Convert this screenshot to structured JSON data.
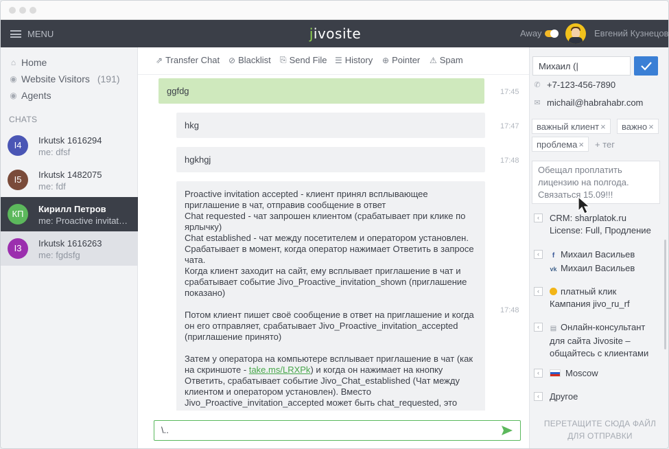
{
  "topbar": {
    "menu_label": "MENU",
    "logo_j": "j",
    "logo_rest": "ivosite",
    "status": "Away",
    "user_name": "Евгений Кузнецов"
  },
  "sidebar": {
    "nav": [
      {
        "label": "Home",
        "icon": "home-icon"
      },
      {
        "label": "Website Visitors",
        "count": "(191)",
        "icon": "visitors-icon"
      },
      {
        "label": "Agents",
        "icon": "agents-icon"
      }
    ],
    "chats_heading": "CHATS",
    "chats": [
      {
        "initials": "I4",
        "name": "Irkutsk 1616294",
        "preview": "me: dfsf",
        "color": "#4a56b5"
      },
      {
        "initials": "I5",
        "name": "Irkutsk 1482075",
        "preview": "me: fdf",
        "color": "#7a4b3a"
      },
      {
        "initials": "КП",
        "name": "Кирилл Петров",
        "preview": "me: Proactive invitation accepted",
        "color": "#5cb85c"
      },
      {
        "initials": "I3",
        "name": "Irkutsk 1616263",
        "preview": "me: fgdsfg",
        "color": "#9b2fae"
      }
    ]
  },
  "toolbar": {
    "transfer": "Transfer Chat",
    "blacklist": "Blacklist",
    "send_file": "Send File",
    "history": "History",
    "pointer": "Pointer",
    "spam": "Spam"
  },
  "messages": [
    {
      "text": "ggfdg",
      "time": "17:45"
    },
    {
      "text": "hkg",
      "time": "17:47"
    },
    {
      "text": "hgkhgj",
      "time": "17:48"
    },
    {
      "time": "17:48",
      "p1": "Proactive invitation accepted - клиент принял всплывающее приглашение в чат, отправив сообщение в ответ\nChat requested - чат запрошен клиентом (срабатывает при клике по ярлычку)\nChat established - чат между посетителем и оператором установлен. Срабатывает в момент, когда оператор нажимает Ответить в запросе чата.\nКогда клиент заходит на сайт, ему всплывает приглашение в чат и срабатывает событие Jivo_Proactive_invitation_shown (приглашение показано)",
      "p2": "Потом клиент пишет своё сообщение в ответ на приглашение и когда он его отправляет, срабатывает Jivo_Proactive_invitation_accepted (приглашение принято)",
      "p3_before": "Затем у оператора на компьютере всплывает приглашение в чат (как на скриншоте - ",
      "p3_link": "take.ms/LRXPk",
      "p3_after": ") и когда он нажимает на кнопку Ответить, срабатывает событие Jivo_Chat_established (Чат между клиентом и оператором установлен). Вместо Jivo_Proactive_invitation_accepted может быть chat_requested, это"
    }
  ],
  "composer": {
    "value": "\\.."
  },
  "visitor": {
    "name_value": "Михаил (|",
    "phone": "+7-123-456-7890",
    "email": "michail@habrahabr.com",
    "tags": [
      "важный клиент",
      "важно",
      "проблема"
    ],
    "add_tag": "+ тег",
    "note": "Обещал проплатить лицензию на полгода. Связаться 15.09!!!",
    "crm_line1": "CRM: sharplatok.ru",
    "crm_line2": "License: Full, Продление",
    "fb_name": "Михаил Васильев",
    "vk_name": "Михаил Васильев",
    "ad_line1": "платный клик",
    "ad_line2": "Кампания jivo_ru_rf",
    "page_line1": "Онлайн-консультант",
    "page_line2": "для сайта Jivosite –",
    "page_line3": "общайтесь с клиентами",
    "city": "Moscow",
    "other": "Другое",
    "drop_line1": "ПЕРЕТАЩИТЕ СЮДА ФАЙЛ",
    "drop_line2": "ДЛЯ ОТПРАВКИ"
  }
}
